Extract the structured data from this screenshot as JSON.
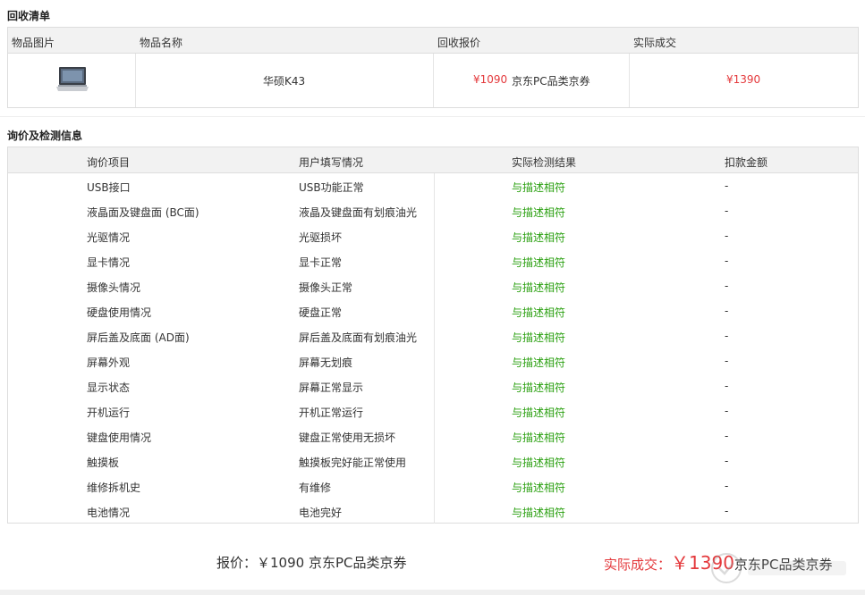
{
  "recycle_list": {
    "title": "回收清单",
    "headers": [
      "物品图片",
      "物品名称",
      "回收报价",
      "实际成交"
    ],
    "item": {
      "image_icon": "laptop-icon",
      "name": "华硕K43",
      "quote_price": "¥1090",
      "quote_coupon": "京东PC品类京券",
      "deal_price": "¥1390"
    }
  },
  "inspection": {
    "title": "询价及检测信息",
    "headers": [
      "询价项目",
      "用户填写情况",
      "实际检测结果",
      "扣款金额"
    ],
    "rows": [
      {
        "item": "USB接口",
        "user": "USB功能正常",
        "result": "与描述相符",
        "deduction": "-"
      },
      {
        "item": "液晶面及键盘面 (BC面)",
        "user": "液晶及键盘面有划痕油光",
        "result": "与描述相符",
        "deduction": "-"
      },
      {
        "item": "光驱情况",
        "user": "光驱损坏",
        "result": "与描述相符",
        "deduction": "-"
      },
      {
        "item": "显卡情况",
        "user": "显卡正常",
        "result": "与描述相符",
        "deduction": "-"
      },
      {
        "item": "摄像头情况",
        "user": "摄像头正常",
        "result": "与描述相符",
        "deduction": "-"
      },
      {
        "item": "硬盘使用情况",
        "user": "硬盘正常",
        "result": "与描述相符",
        "deduction": "-"
      },
      {
        "item": "屏后盖及底面 (AD面)",
        "user": "屏后盖及底面有划痕油光",
        "result": "与描述相符",
        "deduction": "-"
      },
      {
        "item": "屏幕外观",
        "user": "屏幕无划痕",
        "result": "与描述相符",
        "deduction": "-"
      },
      {
        "item": "显示状态",
        "user": "屏幕正常显示",
        "result": "与描述相符",
        "deduction": "-"
      },
      {
        "item": "开机运行",
        "user": "开机正常运行",
        "result": "与描述相符",
        "deduction": "-"
      },
      {
        "item": "键盘使用情况",
        "user": "键盘正常使用无损坏",
        "result": "与描述相符",
        "deduction": "-"
      },
      {
        "item": "触摸板",
        "user": "触摸板完好能正常使用",
        "result": "与描述相符",
        "deduction": "-"
      },
      {
        "item": "维修拆机史",
        "user": "有维修",
        "result": "与描述相符",
        "deduction": "-"
      },
      {
        "item": "电池情况",
        "user": "电池完好",
        "result": "与描述相符",
        "deduction": "-"
      }
    ]
  },
  "footer": {
    "quote_text": "报价：￥1090 京东PC品类京券",
    "deal_label": "实际成交：",
    "deal_amount": "￥1390",
    "deal_coupon": "京东PC品类京券"
  },
  "colors": {
    "accent_red": "#e4393c",
    "match_green": "#2aa010",
    "header_bg": "#f2f2f2",
    "border": "#dddddd"
  }
}
